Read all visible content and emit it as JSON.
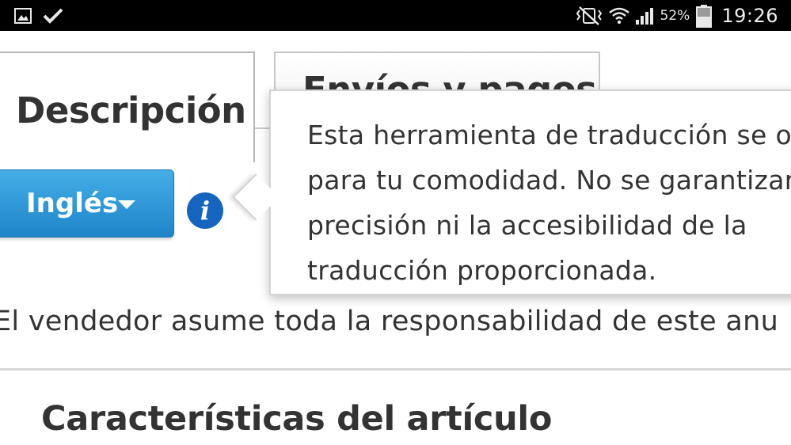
{
  "status_bar": {
    "left_icons": [
      "image-icon",
      "check-icon"
    ],
    "right_icons": [
      "vibrate-mute-icon",
      "wifi-icon",
      "signal-icon",
      "battery-icon"
    ],
    "battery_percent": "52%",
    "time": "19:26"
  },
  "tabs": [
    {
      "label": "Descripción",
      "active": true
    },
    {
      "label": "Envíos y pagos",
      "active": false
    }
  ],
  "language_button": {
    "label": "Inglés",
    "icon": "chevron-down-icon"
  },
  "info_icon": {
    "glyph": "i"
  },
  "tooltip": {
    "lines": [
      "Esta herramienta de traducción se o",
      "para tu comodidad. No se garantizar",
      "precisión ni la accesibilidad de la",
      "traducción proporcionada."
    ]
  },
  "seller_notice": "El vendedor asume toda la responsabilidad de este anu",
  "section_title": "Características del artículo",
  "colors": {
    "button_blue": "#2b95d6",
    "info_blue": "#1565c0",
    "text": "#333333",
    "status_bar_bg": "#000000"
  }
}
